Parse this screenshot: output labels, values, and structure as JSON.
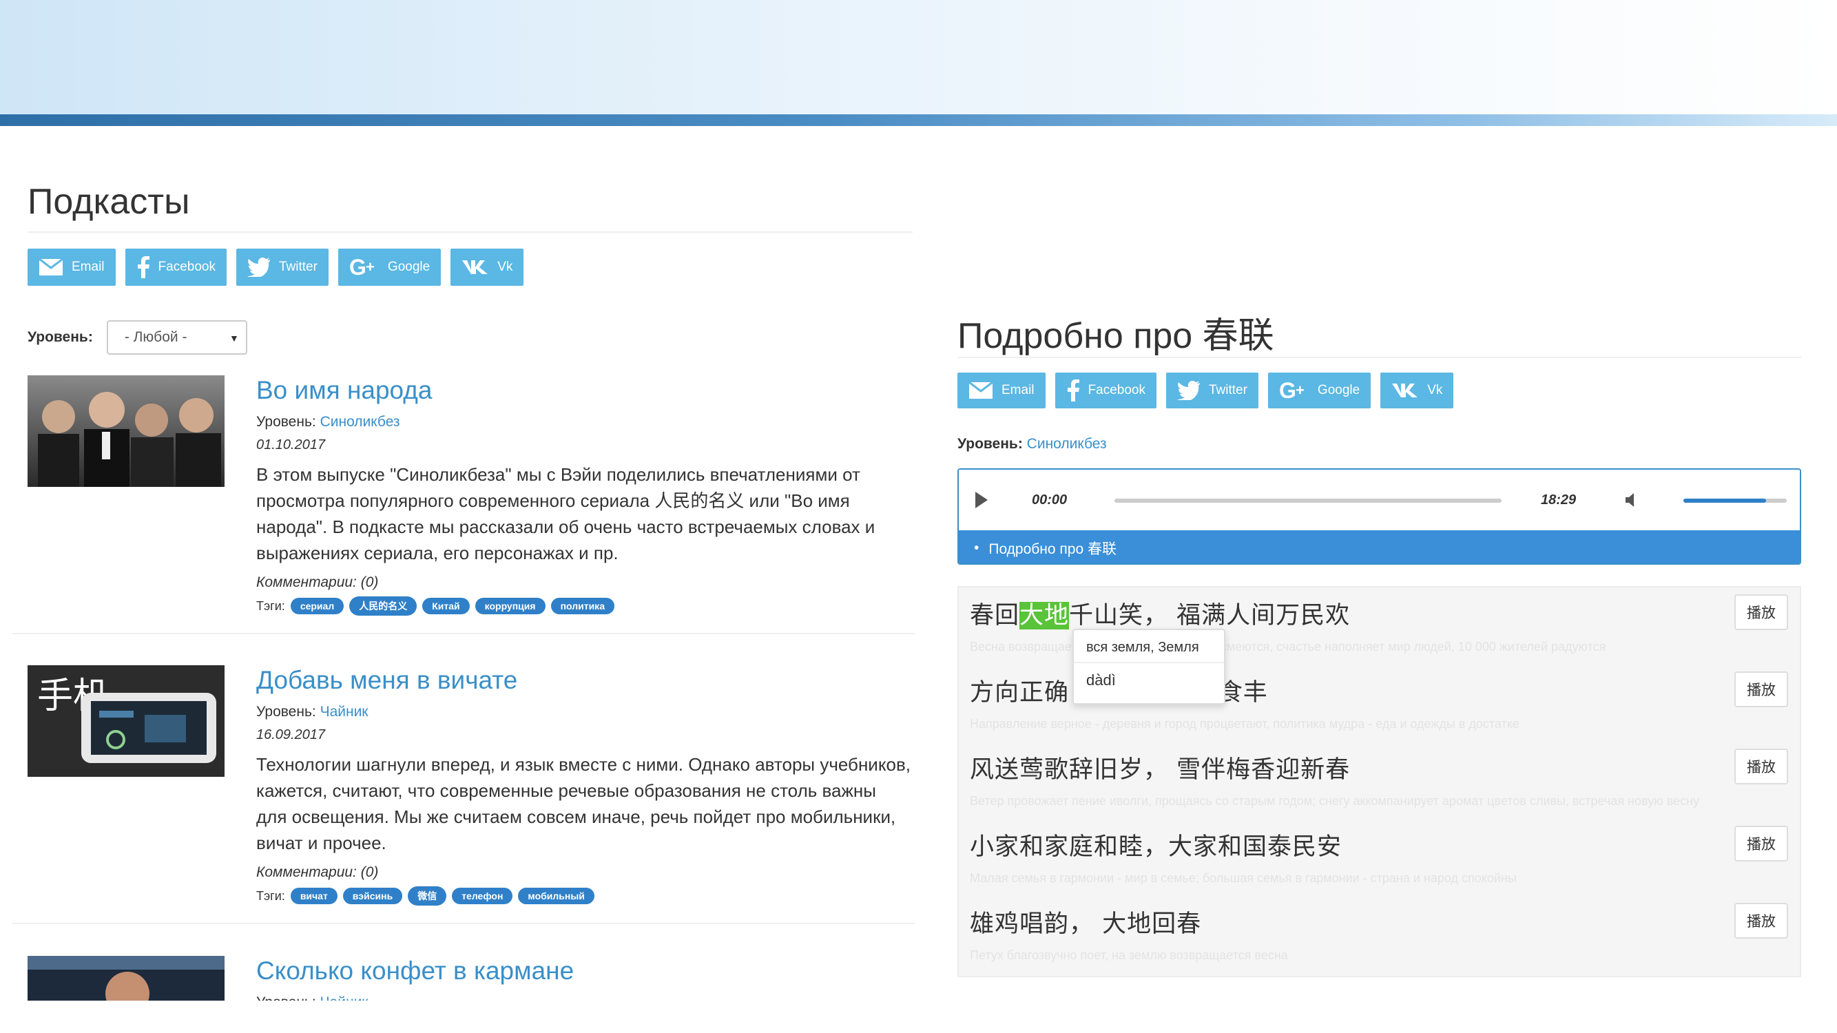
{
  "header": {
    "colors": {
      "banner_bar": "#2f6fa8",
      "share_button": "#5bb7e3",
      "link": "#3a8fc8",
      "tag": "#2f80c8",
      "highlight": "#59c339"
    }
  },
  "share": {
    "email": "Email",
    "facebook": "Facebook",
    "twitter": "Twitter",
    "google": "Google",
    "vk": "Vk"
  },
  "podcasts": {
    "title": "Подкасты",
    "filter": {
      "label": "Уровень:",
      "selected": "- Любой -"
    },
    "items": [
      {
        "title": "Во имя народа",
        "level_label": "Уровень:",
        "level": "Синоликбез",
        "date": "01.10.2017",
        "description": "В этом выпуске \"Синоликбеза\" мы с Вэйи поделились впечатлениями от просмотра популярного современного сериала 人民的名义 или \"Во имя народа\". В подкасте мы рассказали об очень часто встречаемых словах и выражениях сериала, его персонажах и пр.",
        "comments": "Комментарии: (0)",
        "tags_label": "Тэги:",
        "tags": [
          "сериал",
          "人民的名义",
          "Китай",
          "коррупция",
          "политика"
        ]
      },
      {
        "title": "Добавь меня в вичате",
        "level_label": "Уровень:",
        "level": "Чайник",
        "date": "16.09.2017",
        "description": "Технологии шагнули вперед, и язык вместе с ними. Однако авторы учебников, кажется, считают, что современные речевые образования не столь важны для освещения. Мы же считаем совсем иначе, речь пойдет про мобильники, вичат и прочее.",
        "comments": "Комментарии: (0)",
        "tags_label": "Тэги:",
        "tags": [
          "вичат",
          "вэйсинь",
          "微信",
          "телефон",
          "мобильный"
        ],
        "thumb_text": "手机"
      },
      {
        "title": "Сколько конфет в кармане",
        "level_label": "Уровень:",
        "level": "Чайник"
      }
    ]
  },
  "detail": {
    "title": "Подробно про 春联",
    "level_label": "Уровень:",
    "level": "Синоликбез",
    "player": {
      "current_time": "00:00",
      "total_time": "18:29",
      "volume": 0.8,
      "progress": 0,
      "playlist_item": "Подробно про 春联"
    },
    "lyrics": [
      {
        "before": "春回",
        "highlight": "大地",
        "after": "千山笑，  福满人间万民欢",
        "translation": "Весна возвращается на землю, тысячи гор смеются, счастье наполняет мир людей, 10 000 жителей радуются",
        "button": "播放"
      },
      {
        "before": "方向正确",
        "highlight": "",
        "after": "      营英明衣食丰",
        "translation": "Направление верное - деревня и город процветают, политика мудра - еда и одежды в достатке",
        "button": "播放"
      },
      {
        "before": "",
        "highlight": "",
        "after": "风送莺歌辞旧岁，  雪伴梅香迎新春",
        "translation": "Ветер провожает пение иволги, прощаясь со старым годом; снегу аккомпанирует аромат цветов сливы, встречая новую весну",
        "button": "播放"
      },
      {
        "before": "",
        "highlight": "",
        "after": "小家和家庭和睦，大家和国泰民安",
        "translation": "Малая семья в гармонии - мир в семье; большая семья в гармонии - страна и народ спокойны",
        "button": "播放"
      },
      {
        "before": "",
        "highlight": "",
        "after": "雄鸡唱韵，  大地回春",
        "translation": "Петух благозвучно поет, на землю возвращается весна",
        "button": "播放"
      }
    ],
    "tooltip": {
      "meaning": "вся земля, Земля",
      "pinyin": "dàdì"
    }
  }
}
